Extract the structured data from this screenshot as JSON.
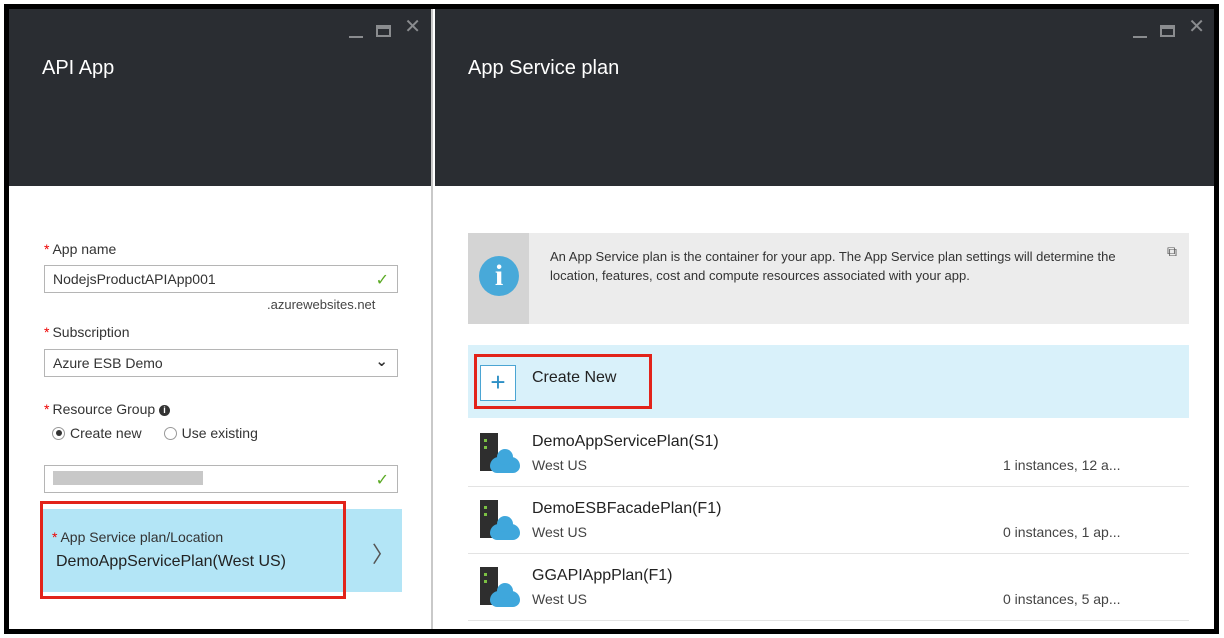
{
  "left_blade": {
    "title": "API App",
    "app_name": {
      "label": "App name",
      "value": "NodejsProductAPIApp001",
      "suffix": ".azurewebsites.net"
    },
    "subscription": {
      "label": "Subscription",
      "value": "Azure ESB Demo"
    },
    "resource_group": {
      "label": "Resource Group",
      "option_new": "Create new",
      "option_existing": "Use existing"
    },
    "plan": {
      "label": "App Service plan/Location",
      "value": "DemoAppServicePlan(West US)"
    }
  },
  "right_blade": {
    "title": "App Service plan",
    "info_text": "An App Service plan is the container for your app. The App Service plan settings will determine the location, features, cost and compute resources associated with your app.",
    "create_new": "Create New",
    "plans": [
      {
        "name": "DemoAppServicePlan(S1)",
        "location": "West US",
        "instances": "1 instances, 12 a..."
      },
      {
        "name": "DemoESBFacadePlan(F1)",
        "location": "West US",
        "instances": "0 instances, 1 ap..."
      },
      {
        "name": "GGAPIAppPlan(F1)",
        "location": "West US",
        "instances": "0 instances, 5 ap..."
      }
    ]
  },
  "glyphs": {
    "close": "✕",
    "check": "✓",
    "chevron_down": "⌄",
    "chevron_right": "〉",
    "plus": "+",
    "info": "i",
    "external": "⧉",
    "required": "*",
    "info_dot": "i"
  },
  "colors": {
    "header_bg": "#2a2d32",
    "selected_row": "#b3e5f6",
    "create_row": "#d9f1fa",
    "highlight_box": "#e2231a",
    "check": "#5aaa23"
  }
}
